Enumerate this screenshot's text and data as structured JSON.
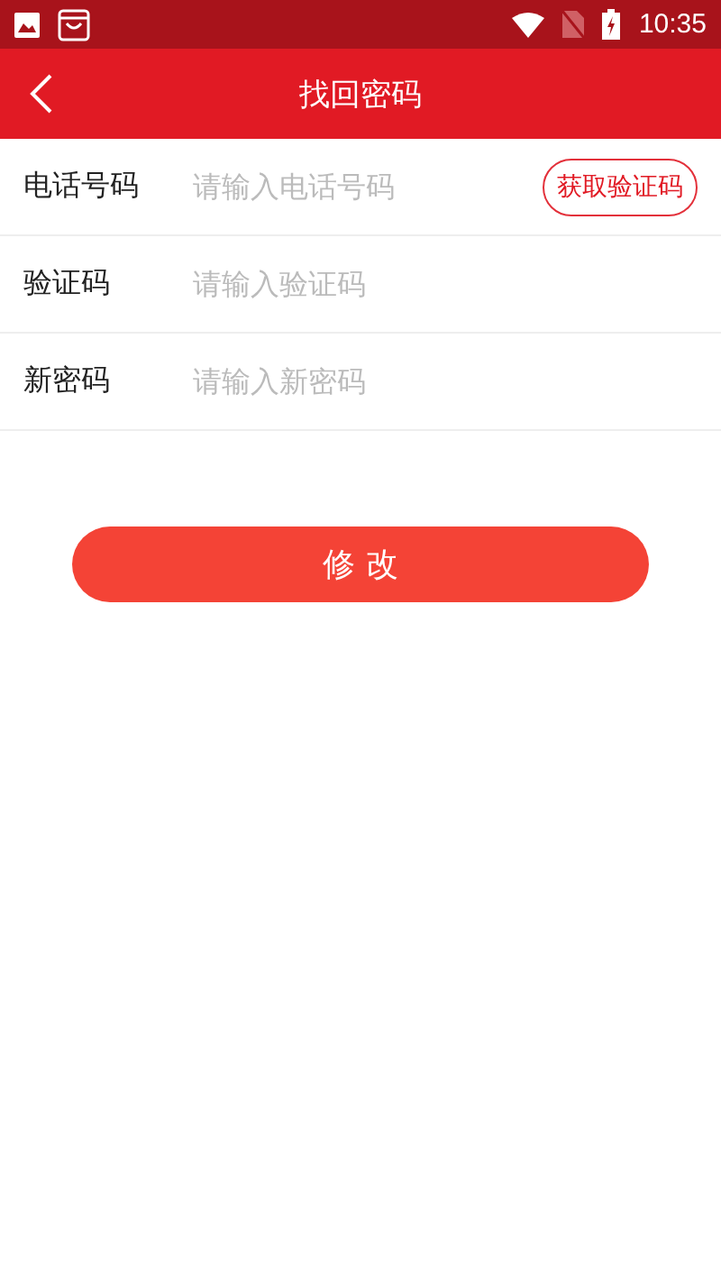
{
  "status_bar": {
    "time": "10:35"
  },
  "nav_bar": {
    "title": "找回密码"
  },
  "fields": [
    {
      "label": "电话号码",
      "placeholder": "请输入电话号码",
      "action": "获取验证码"
    },
    {
      "label": "验证码",
      "placeholder": "请输入验证码"
    },
    {
      "label": "新密码",
      "placeholder": "请输入新密码"
    }
  ],
  "submit_button": "修 改"
}
